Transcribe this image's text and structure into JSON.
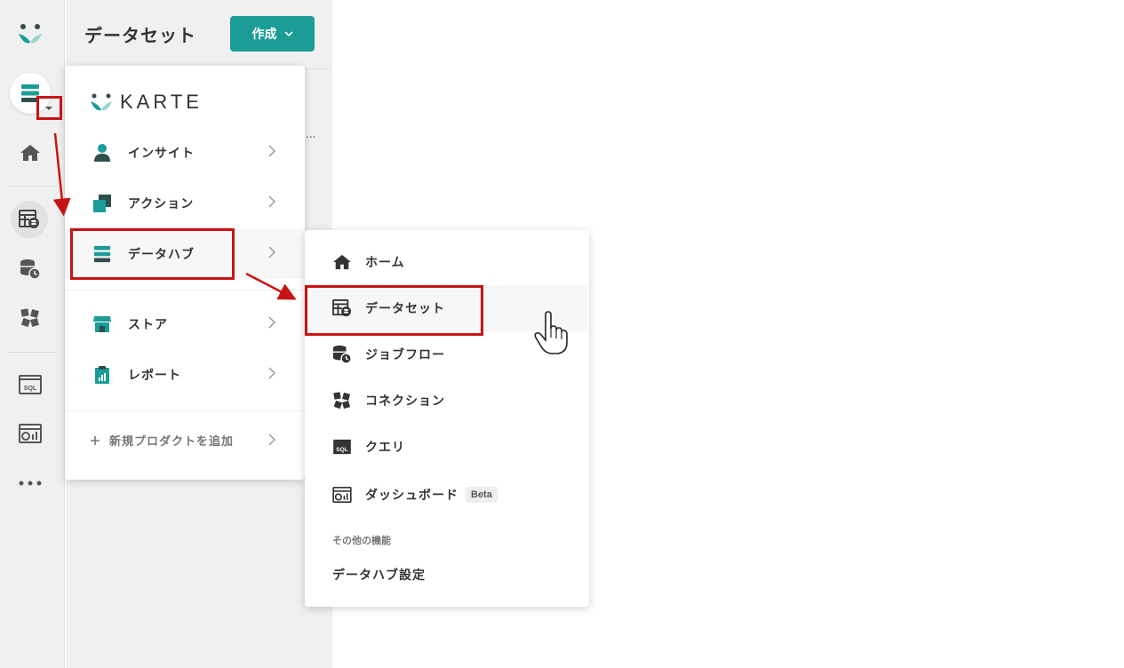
{
  "panel": {
    "title": "データセット",
    "create_label": "作成"
  },
  "logo": {
    "text": "KARTE"
  },
  "products": [
    {
      "label": "インサイト",
      "icon": "person-icon"
    },
    {
      "label": "アクション",
      "icon": "layers-icon"
    },
    {
      "label": "データハブ",
      "icon": "database-stack-icon"
    },
    {
      "label": "ストア",
      "icon": "store-icon"
    },
    {
      "label": "レポート",
      "icon": "clipboard-chart-icon"
    }
  ],
  "add_product_label": "新規プロダクトを追加",
  "datahub": {
    "items": [
      {
        "label": "ホーム",
        "icon": "home-icon"
      },
      {
        "label": "データセット",
        "icon": "dataset-icon"
      },
      {
        "label": "ジョブフロー",
        "icon": "jobflow-icon"
      },
      {
        "label": "コネクション",
        "icon": "connection-icon"
      },
      {
        "label": "クエリ",
        "icon": "sql-icon"
      },
      {
        "label": "ダッシュボード",
        "icon": "dashboard-icon",
        "badge": "Beta"
      }
    ],
    "section_label": "その他の機能",
    "settings_label": "データハブ設定"
  },
  "colors": {
    "brand": "#1b9c96",
    "annotation": "#c81414"
  }
}
